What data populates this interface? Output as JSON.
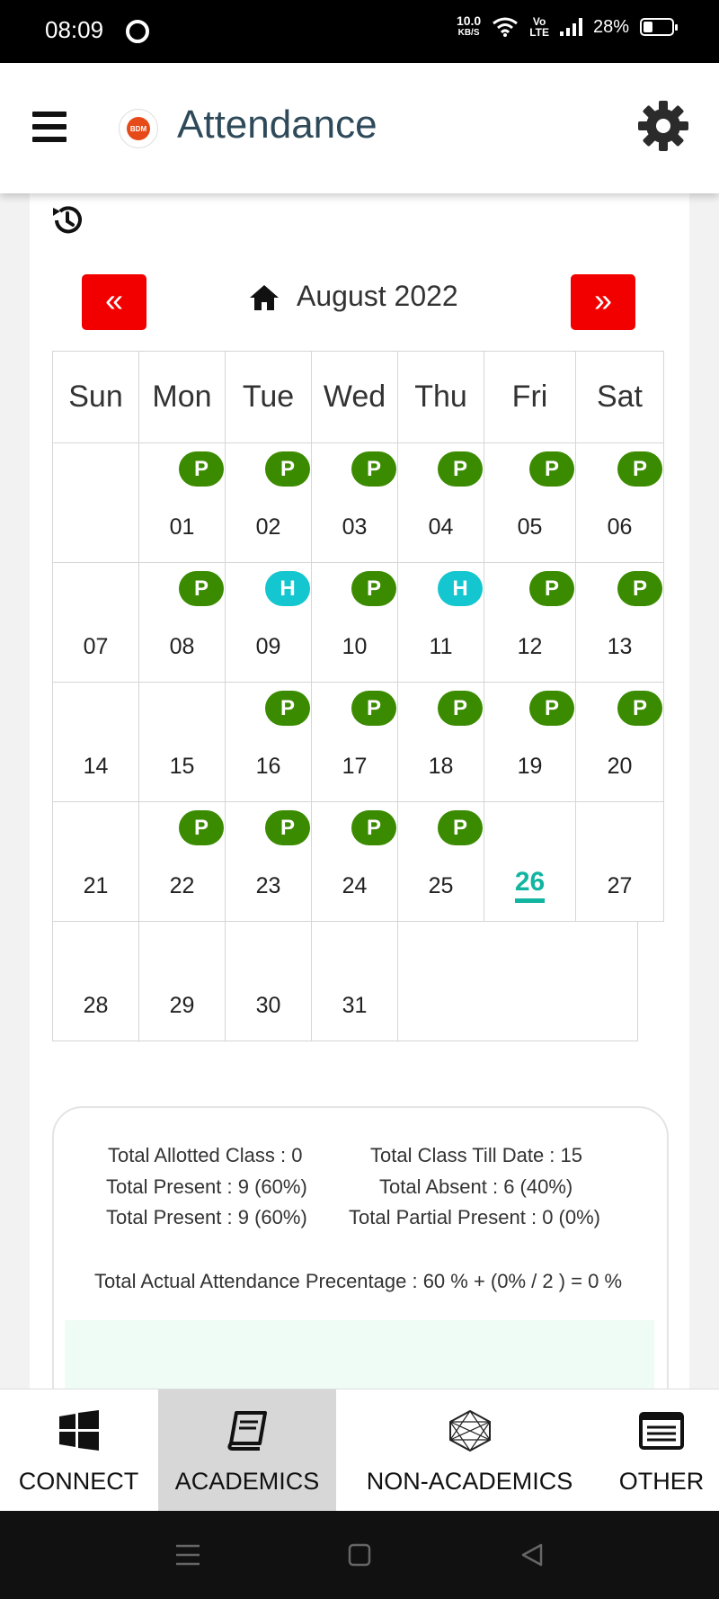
{
  "status": {
    "time": "08:09",
    "net_speed": "10.0",
    "net_unit": "KB/S",
    "volte_top": "Vo",
    "volte_bottom": "LTE",
    "battery": "28%"
  },
  "header": {
    "title": "Attendance",
    "logo_text": "BDM"
  },
  "calendar": {
    "month_label": "August 2022",
    "prev_label": "«",
    "next_label": "»",
    "weekdays": [
      "Sun",
      "Mon",
      "Tue",
      "Wed",
      "Thu",
      "Fri",
      "Sat"
    ],
    "weeks": [
      [
        {
          "d": ""
        },
        {
          "d": "01",
          "s": "P"
        },
        {
          "d": "02",
          "s": "P"
        },
        {
          "d": "03",
          "s": "P"
        },
        {
          "d": "04",
          "s": "P"
        },
        {
          "d": "05",
          "s": "P"
        },
        {
          "d": "06",
          "s": "P"
        }
      ],
      [
        {
          "d": "07"
        },
        {
          "d": "08",
          "s": "P"
        },
        {
          "d": "09",
          "s": "H"
        },
        {
          "d": "10",
          "s": "P"
        },
        {
          "d": "11",
          "s": "H"
        },
        {
          "d": "12",
          "s": "P"
        },
        {
          "d": "13",
          "s": "P"
        }
      ],
      [
        {
          "d": "14"
        },
        {
          "d": "15"
        },
        {
          "d": "16",
          "s": "P"
        },
        {
          "d": "17",
          "s": "P"
        },
        {
          "d": "18",
          "s": "P"
        },
        {
          "d": "19",
          "s": "P"
        },
        {
          "d": "20",
          "s": "P"
        }
      ],
      [
        {
          "d": "21"
        },
        {
          "d": "22",
          "s": "P"
        },
        {
          "d": "23",
          "s": "P"
        },
        {
          "d": "24",
          "s": "P"
        },
        {
          "d": "25",
          "s": "P"
        },
        {
          "d": "26",
          "today": true
        },
        {
          "d": "27"
        }
      ],
      [
        {
          "d": "28"
        },
        {
          "d": "29"
        },
        {
          "d": "30"
        },
        {
          "d": "31"
        }
      ]
    ],
    "colors": {
      "present": "#3b8b00",
      "holiday": "#14c6cf",
      "today": "#12b5a0",
      "nav_button": "#f20000"
    }
  },
  "summary": {
    "total_allotted": "Total Allotted Class : 0",
    "total_till_date": "Total Class Till Date : 15",
    "total_present_1": "Total Present : 9 (60%)",
    "total_absent": "Total Absent : 6 (40%)",
    "total_present_2": "Total Present : 9 (60%)",
    "total_partial": "Total Partial Present : 0 (0%)",
    "actual": "Total Actual Attendance Precentage : 60 % + (0% / 2 ) = 0 %"
  },
  "bottom_nav": {
    "connect": "CONNECT",
    "academics": "ACADEMICS",
    "non_academics": "NON-ACADEMICS",
    "other": "OTHER",
    "active": "ACADEMICS"
  }
}
